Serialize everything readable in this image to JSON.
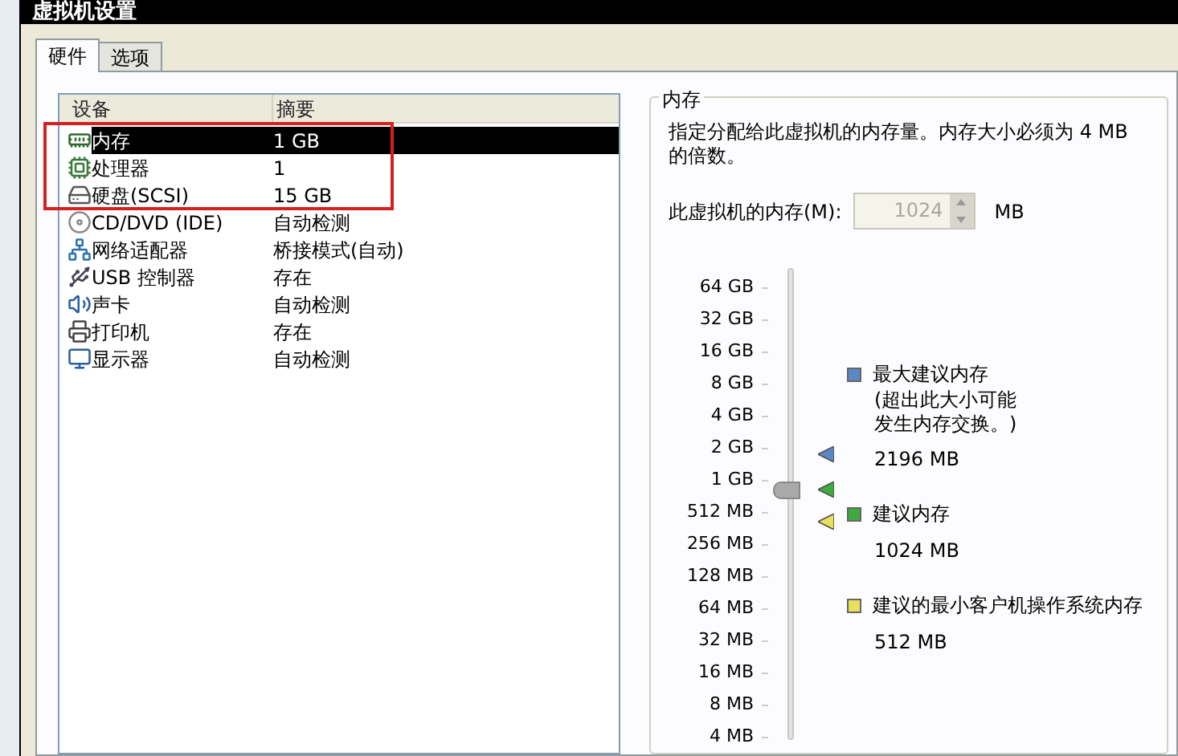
{
  "window": {
    "title": "虚拟机设置"
  },
  "tabs": [
    {
      "label": "硬件",
      "selected": true
    },
    {
      "label": "选项",
      "selected": false
    }
  ],
  "device_list": {
    "columns": [
      "设备",
      "摘要"
    ],
    "rows": [
      {
        "kind": "memory",
        "device": "内存",
        "summary": "1 GB",
        "selected": true
      },
      {
        "kind": "cpu",
        "device": "处理器",
        "summary": "1",
        "selected": false
      },
      {
        "kind": "disk",
        "device": "硬盘(SCSI)",
        "summary": "15 GB",
        "selected": false
      },
      {
        "kind": "cdrom",
        "device": "CD/DVD (IDE)",
        "summary": "自动检测",
        "selected": false
      },
      {
        "kind": "network",
        "device": "网络适配器",
        "summary": "桥接模式(自动)",
        "selected": false
      },
      {
        "kind": "usb",
        "device": "USB 控制器",
        "summary": "存在",
        "selected": false
      },
      {
        "kind": "sound",
        "device": "声卡",
        "summary": "自动检测",
        "selected": false
      },
      {
        "kind": "printer",
        "device": "打印机",
        "summary": "存在",
        "selected": false
      },
      {
        "kind": "display",
        "device": "显示器",
        "summary": "自动检测",
        "selected": false
      }
    ]
  },
  "memory": {
    "title": "内存",
    "description": "指定分配给此虚拟机的内存量。内存大小必须为 4 MB 的倍数。",
    "field_label": "此虚拟机的内存(M):",
    "value": "1024",
    "disabled": true,
    "unit": "MB",
    "scale": [
      "64 GB",
      "32 GB",
      "16 GB",
      "8 GB",
      "4 GB",
      "2 GB",
      "1 GB",
      "512 MB",
      "256 MB",
      "128 MB",
      "64 MB",
      "32 MB",
      "16 MB",
      "8 MB",
      "4 MB"
    ],
    "slider": {
      "level": 0.571
    },
    "markers": [
      {
        "color": "#5b87c4",
        "level": 0.65
      },
      {
        "color": "#3faa3f",
        "level": 0.571
      },
      {
        "color": "#e8e05a",
        "level": 0.5
      }
    ],
    "legend": [
      {
        "color": "#5b87c4",
        "title": "最大建议内存",
        "note_lines": [
          "(超出此大小可能",
          "发生内存交换。)"
        ],
        "value": "2196 MB"
      },
      {
        "color": "#3faa3f",
        "title": "建议内存",
        "value": "1024 MB"
      },
      {
        "color": "#e8e05a",
        "title": "建议的最小客户机操作系统内存",
        "value": "512 MB"
      }
    ]
  }
}
